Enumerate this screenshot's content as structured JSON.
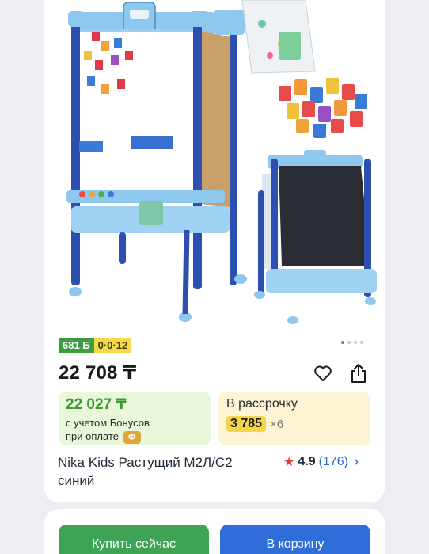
{
  "product": {
    "badges": {
      "bonus": "681 Б",
      "installment": "0·0·12"
    },
    "price": "22 708 ₸",
    "bonus_price": "22 027 ₸",
    "bonus_note_line1": "с учетом Бонусов",
    "bonus_note_line2": "при оплате",
    "pay_chip": "Ф",
    "installment_title": "В рассрочку",
    "installment_amount": "3 785",
    "installment_multiplier": "×6",
    "title": "Nika Kids Растущий М2Л/С2 синий",
    "rating": "4.9",
    "reviews": "(176)"
  },
  "gallery": {
    "total_dots": 4,
    "active_dot": 1
  },
  "actions": {
    "buy_now": "Купить сейчас",
    "add_to_cart": "В корзину"
  },
  "icons": {
    "favorite": "heart-icon",
    "share": "share-icon",
    "rating": "star-icon",
    "open": "chevron-right-icon"
  },
  "colors": {
    "bonus_green": "#3d9a2f",
    "installment_yellow": "#f3d64a",
    "buy_button": "#3fa355",
    "cart_button": "#2f6ed8",
    "rating_star": "#e53b3b",
    "link_blue": "#2f66c7"
  }
}
